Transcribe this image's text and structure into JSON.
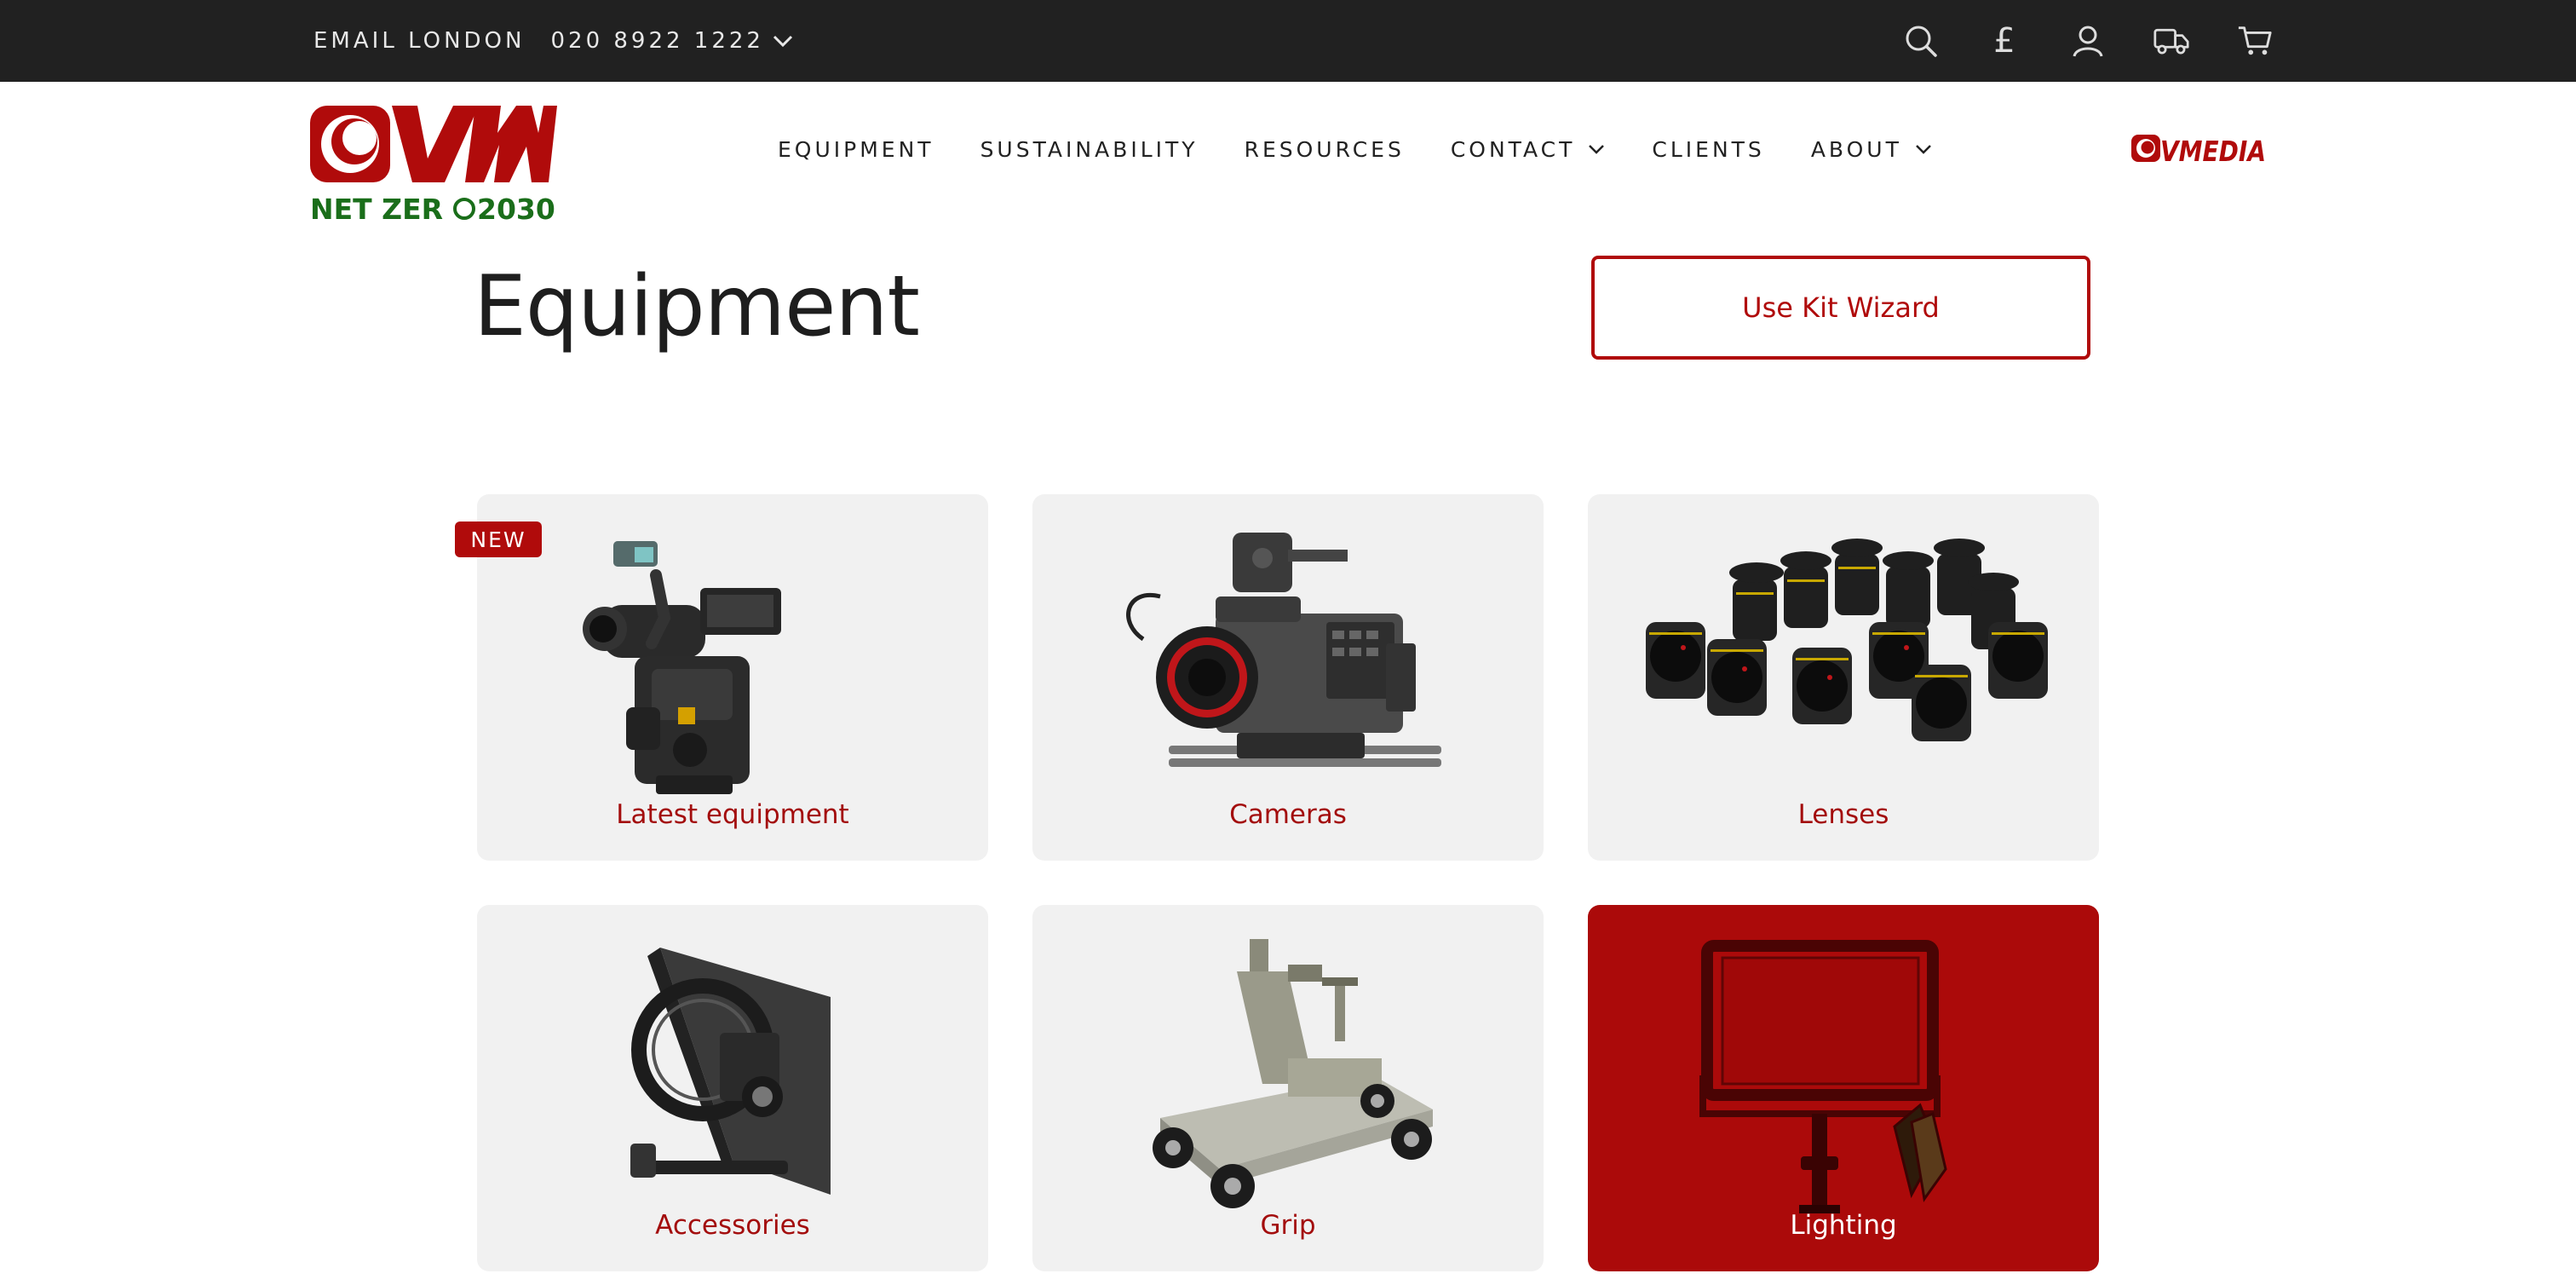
{
  "topbar": {
    "email_label": "EMAIL LONDON",
    "phone": "020 8922 1222",
    "icons": [
      "search-icon",
      "currency-pound-icon",
      "account-icon",
      "delivery-truck-icon",
      "cart-icon"
    ],
    "currency_symbol": "£"
  },
  "header": {
    "logo": {
      "brand": "VMI",
      "tagline": "NET ZERO 2030"
    },
    "nav": [
      {
        "label": "EQUIPMENT",
        "has_dropdown": false
      },
      {
        "label": "SUSTAINABILITY",
        "has_dropdown": false
      },
      {
        "label": "RESOURCES",
        "has_dropdown": false
      },
      {
        "label": "CONTACT",
        "has_dropdown": true
      },
      {
        "label": "CLIENTS",
        "has_dropdown": false
      },
      {
        "label": "ABOUT",
        "has_dropdown": true
      }
    ],
    "vmedia_logo": "VMEDIA"
  },
  "main": {
    "title": "Equipment",
    "kit_wizard_label": "Use Kit Wizard",
    "badge": "NEW",
    "categories": [
      {
        "label": "Latest equipment",
        "image": "gimbal-camera-rig"
      },
      {
        "label": "Cameras",
        "image": "cinema-camera"
      },
      {
        "label": "Lenses",
        "image": "cinema-lens-set"
      },
      {
        "label": "Accessories",
        "image": "matte-box"
      },
      {
        "label": "Grip",
        "image": "camera-dolly"
      },
      {
        "label": "Lighting",
        "image": "led-panel-light"
      }
    ]
  },
  "colors": {
    "brand_red": "#b00b0b",
    "topbar_bg": "#212121",
    "card_bg": "#f1f1f1",
    "card_active_bg": "#ab0a0a",
    "tagline_green": "#1a6e1a"
  }
}
